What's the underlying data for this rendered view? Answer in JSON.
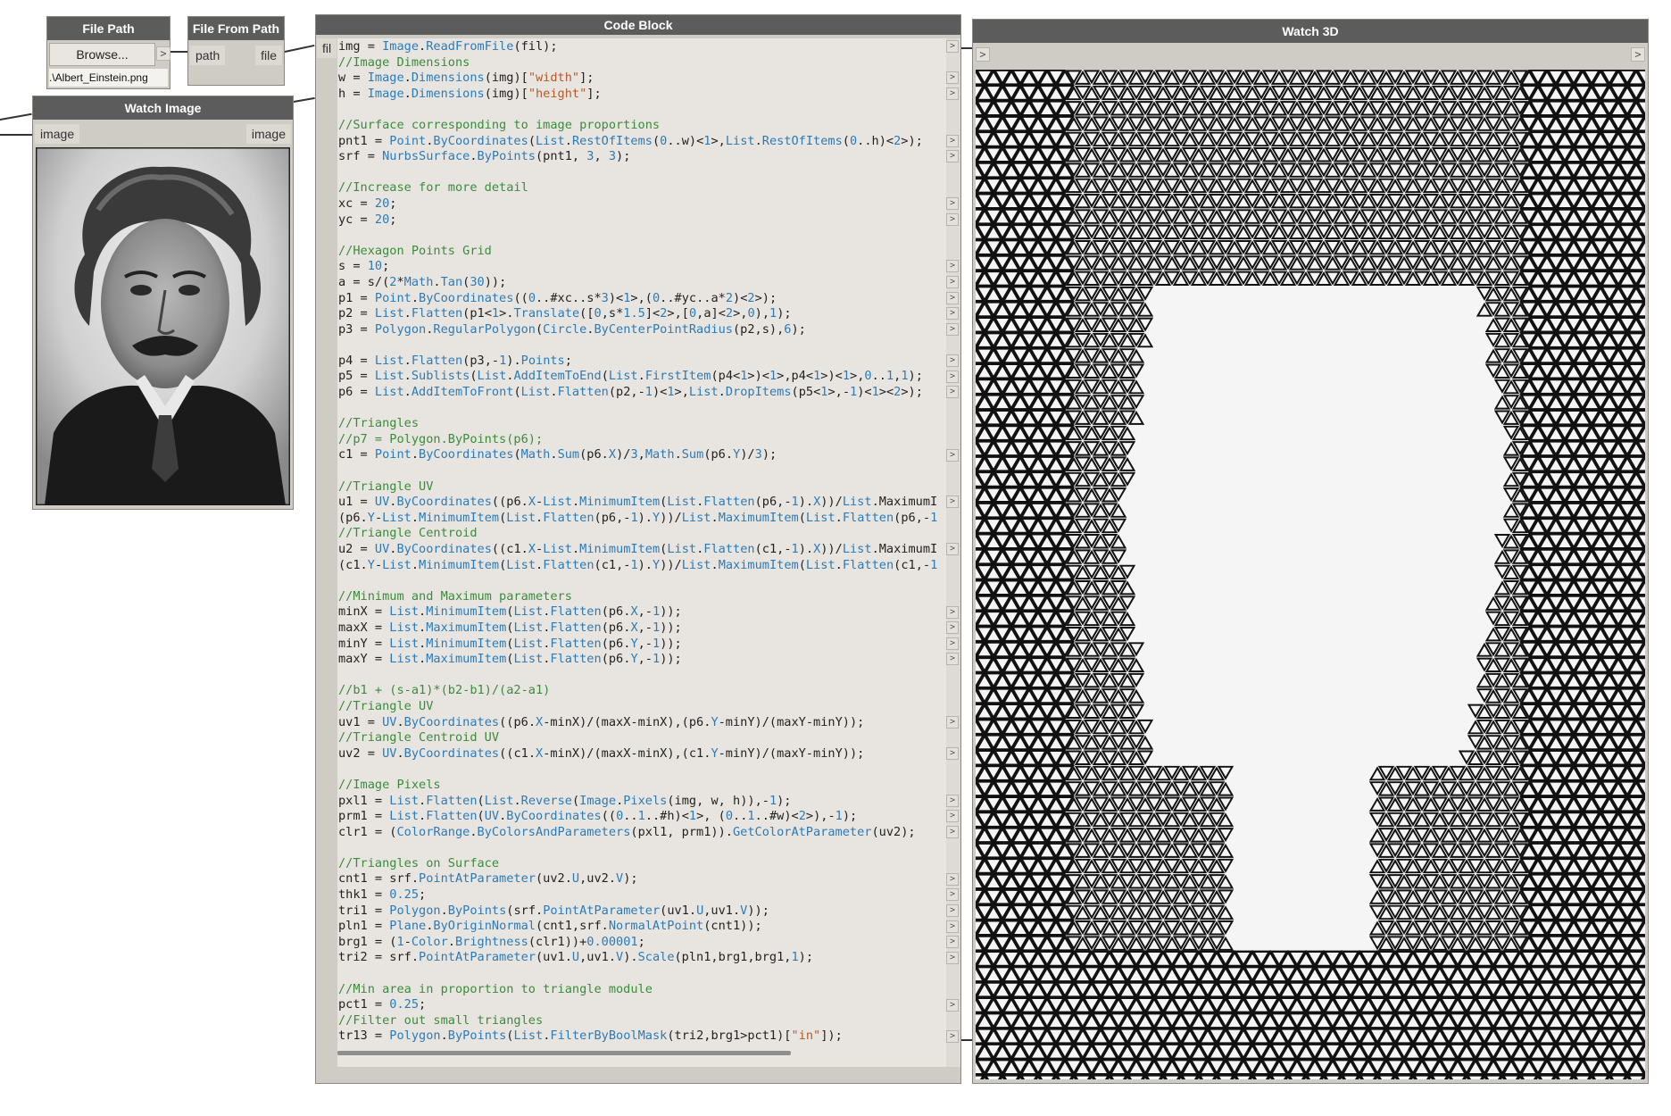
{
  "nodes": {
    "file_path": {
      "title": "File Path",
      "browse_label": "Browse...",
      "output_caret": ">",
      "value": ".\\Albert_Einstein.png"
    },
    "file_from_path": {
      "title": "File From Path",
      "input_port": "path",
      "output_port": "file"
    },
    "watch_image": {
      "title": "Watch Image",
      "input_port": "image",
      "output_port": "image"
    },
    "code_block": {
      "title": "Code Block",
      "input_port": "fil"
    },
    "watch_3d": {
      "title": "Watch 3D",
      "input_caret": ">",
      "output_caret": ">"
    }
  },
  "code_lines": [
    "img = Image.ReadFromFile(fil);",
    "//Image Dimensions",
    "w = Image.Dimensions(img)[\"width\"];",
    "h = Image.Dimensions(img)[\"height\"];",
    "",
    "//Surface corresponding to image proportions",
    "pnt1 = Point.ByCoordinates(List.RestOfItems(0..w)<1>,List.RestOfItems(0..h)<2>);",
    "srf = NurbsSurface.ByPoints(pnt1, 3, 3);",
    "",
    "//Increase for more detail",
    "xc = 20;",
    "yc = 20;",
    "",
    "//Hexagon Points Grid",
    "s = 10;",
    "a = s/(2*Math.Tan(30));",
    "p1 = Point.ByCoordinates((0..#xc..s*3)<1>,(0..#yc..a*2)<2>);",
    "p2 = List.Flatten(p1<1>.Translate([0,s*1.5]<2>,[0,a]<2>,0),1);",
    "p3 = Polygon.RegularPolygon(Circle.ByCenterPointRadius(p2,s),6);",
    "",
    "p4 = List.Flatten(p3,-1).Points;",
    "p5 = List.Sublists(List.AddItemToEnd(List.FirstItem(p4<1>)<1>,p4<1>)<1>,0..1,1);",
    "p6 = List.AddItemToFront(List.Flatten(p2,-1)<1>,List.DropItems(p5<1>,-1)<1><2>);",
    "",
    "//Triangles",
    "//p7 = Polygon.ByPoints(p6);",
    "c1 = Point.ByCoordinates(Math.Sum(p6.X)/3,Math.Sum(p6.Y)/3);",
    "",
    "//Triangle UV",
    "u1 = UV.ByCoordinates((p6.X-List.MinimumItem(List.Flatten(p6,-1).X))/List.MaximumI",
    "(p6.Y-List.MinimumItem(List.Flatten(p6,-1).Y))/List.MaximumItem(List.Flatten(p6,-1",
    "//Triangle Centroid",
    "u2 = UV.ByCoordinates((c1.X-List.MinimumItem(List.Flatten(c1,-1).X))/List.MaximumI",
    "(c1.Y-List.MinimumItem(List.Flatten(c1,-1).Y))/List.MaximumItem(List.Flatten(c1,-1",
    "",
    "//Minimum and Maximum parameters",
    "minX = List.MinimumItem(List.Flatten(p6.X,-1));",
    "maxX = List.MaximumItem(List.Flatten(p6.X,-1));",
    "minY = List.MinimumItem(List.Flatten(p6.Y,-1));",
    "maxY = List.MaximumItem(List.Flatten(p6.Y,-1));",
    "",
    "//b1 + (s-a1)*(b2-b1)/(a2-a1)",
    "//Triangle UV",
    "uv1 = UV.ByCoordinates((p6.X-minX)/(maxX-minX),(p6.Y-minY)/(maxY-minY));",
    "//Triangle Centroid UV",
    "uv2 = UV.ByCoordinates((c1.X-minX)/(maxX-minX),(c1.Y-minY)/(maxY-minY));",
    "",
    "//Image Pixels",
    "pxl1 = List.Flatten(List.Reverse(Image.Pixels(img, w, h)),-1);",
    "prm1 = List.Flatten(UV.ByCoordinates((0..1..#h)<1>, (0..1..#w)<2>),-1);",
    "clr1 = (ColorRange.ByColorsAndParameters(pxl1, prm1)).GetColorAtParameter(uv2);",
    "",
    "//Triangles on Surface",
    "cnt1 = srf.PointAtParameter(uv2.U,uv2.V);",
    "thk1 = 0.25;",
    "tri1 = Polygon.ByPoints(srf.PointAtParameter(uv1.U,uv1.V));",
    "pln1 = Plane.ByOriginNormal(cnt1,srf.NormalAtPoint(cnt1));",
    "brg1 = (1-Color.Brightness(clr1))+0.00001;",
    "tri2 = srf.PointAtParameter(uv1.U,uv1.V).Scale(pln1,brg1,brg1,1);",
    "",
    "//Min area in proportion to triangle module",
    "pct1 = 0.25;",
    "//Filter out small triangles",
    "tr13 = Polygon.ByPoints(List.FilterByBoolMask(tri2,brg1>pct1)[\"in\"]);"
  ],
  "line_output_carets": [
    0,
    2,
    3,
    6,
    7,
    10,
    11,
    14,
    15,
    16,
    17,
    18,
    20,
    21,
    22,
    26,
    29,
    32,
    36,
    37,
    38,
    39,
    43,
    45,
    48,
    49,
    50,
    53,
    54,
    55,
    56,
    57,
    58,
    61,
    63
  ],
  "caret_glyph": ">",
  "colors": {
    "node_header": "#5c5c5c",
    "node_body": "#cfcbc5",
    "code_background": "#e8e5e1",
    "comment": "#3c8b3c",
    "keyword": "#2c7bb6",
    "string": "#b55a2a",
    "preview_background": "#f5f5f5",
    "preview_lines": "#111111"
  },
  "icons": {
    "portrait": "einstein-portrait-image",
    "lattice": "triangle-lattice-preview"
  }
}
